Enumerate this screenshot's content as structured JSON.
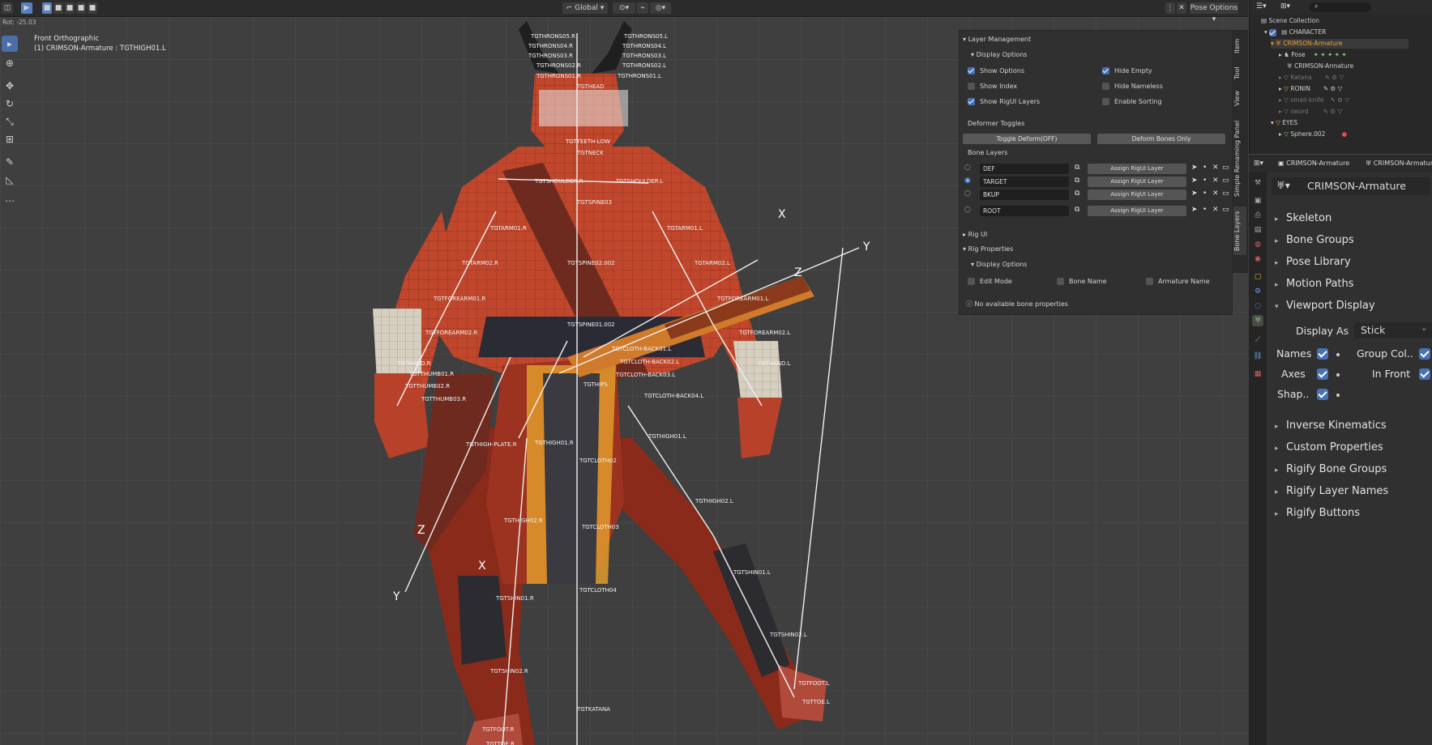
{
  "header": {
    "orientation": "Global",
    "pose_options": "Pose Options"
  },
  "viewport": {
    "coord_readout": "Rot: -25.03",
    "view_name": "Front Orthographic",
    "active_object": "(1) CRIMSON-Armature : TGTHIGH01.L",
    "bone_labels": [
      "TGTHRONS05.R",
      "TGTHRONS05.L",
      "TGTHRONS04.R",
      "TGTHRONS04.L",
      "TGTHRONS03.R",
      "TGTHRONS03.L",
      "TGTHRONS02.R",
      "TGTHRONS02.L",
      "TGTHRONS01.R",
      "TGTHRONS01.L",
      "TGTHEAD",
      "TGTNECK",
      "TGTTEETH-LOW",
      "TGTSHOULDER.R",
      "TGTSHOULDER.L",
      "TGTSPINE03",
      "TGTARM01.R",
      "TGTARM01.L",
      "TGTARM02.R",
      "TGTARM02.L",
      "TGTSPINE02.002",
      "TGTFOREARM01.R",
      "TGTFOREARM01.L",
      "TGTFOREARM02.R",
      "TGTFOREARM02.L",
      "TGTSPINE01.002",
      "TGTCLOTH-BACK01.L",
      "TGTHAND.R",
      "TGTHAND.L",
      "TGTCLOTH-BACK02.L",
      "TGTTHUMB01.R",
      "TGTCLOTH-BACK03.L",
      "TGTTHUMB02.R",
      "TGTCLOTH-BACK04.L",
      "TGTTHUMB03.R",
      "TGTHIPS",
      "TGTHIGH01.L",
      "TGTHIGH-PLATE.R",
      "TGTHIGH01.R",
      "TGTCLOTH02",
      "TGTHIGH02.L",
      "TGTHIGH02.R",
      "TGTCLOTH03",
      "TGTSHIN01.L",
      "TGTSHIN01.R",
      "TGTCLOTH04",
      "TGTSHIN02.L",
      "TGTSHIN02.R",
      "TGTKATANA",
      "TGTFOOT.L",
      "TGTTOE.L",
      "TGTFOOT.R",
      "TGTTOE.R"
    ]
  },
  "npanel": {
    "layer_management": "Layer Management",
    "display_options": "Display Options",
    "options": [
      {
        "label": "Show Options",
        "checked": true
      },
      {
        "label": "Hide Empty",
        "checked": true
      },
      {
        "label": "Show Index",
        "checked": false
      },
      {
        "label": "Hide Nameless",
        "checked": false
      },
      {
        "label": "Show RigUI Layers",
        "checked": true
      },
      {
        "label": "Enable Sorting",
        "checked": false
      }
    ],
    "deformer_toggles": "Deformer Toggles",
    "toggle_deform": "Toggle Deform(OFF)",
    "deform_bones_only": "Deform Bones Only",
    "bone_layers": "Bone Layers",
    "layers": [
      {
        "name": "DEF",
        "assign": "Assign RigUI Layer"
      },
      {
        "name": "TARGET",
        "assign": "Assign RigUI Layer"
      },
      {
        "name": "BKUP",
        "assign": "Assign RigUI Layer"
      },
      {
        "name": "ROOT",
        "assign": "Assign RigUI Layer"
      }
    ],
    "rig_ui": "Rig UI",
    "rig_properties": "Rig Properties",
    "display_options2": "Display Options",
    "rig_opts": [
      {
        "label": "Edit Mode",
        "checked": false
      },
      {
        "label": "Bone Name",
        "checked": false
      },
      {
        "label": "Armature Name",
        "checked": false
      }
    ],
    "no_props": "No available bone properties"
  },
  "vtabs": [
    "Item",
    "Tool",
    "View",
    "Simple Renaming Panel",
    "Bone Layers"
  ],
  "outliner": {
    "rows": [
      "Scene Collection",
      "CHARACTER",
      "CRIMSON-Armature",
      "Pose",
      "CRIMSON-Armature",
      "Katana",
      "RONIN",
      "small-knife",
      "sword",
      "EYES",
      "Sphere.002"
    ]
  },
  "props_header": {
    "left": "CRIMSON-Armature",
    "right": "CRIMSON-Armature"
  },
  "properties": {
    "object_name": "CRIMSON-Armature",
    "sections_top": [
      "Skeleton",
      "Bone Groups",
      "Pose Library",
      "Motion Paths"
    ],
    "viewport_display": "Viewport Display",
    "display_as_label": "Display As",
    "display_as_value": "Stick",
    "names": "Names",
    "group_col": "Group Col..",
    "axes": "Axes",
    "in_front": "In Front",
    "shape": "Shap..",
    "sections_bottom": [
      "Inverse Kinematics",
      "Custom Properties",
      "Rigify Bone Groups",
      "Rigify Layer Names",
      "Rigify Buttons"
    ]
  },
  "colors": {
    "accent": "#4772b3",
    "active_orange": "#f0a43a",
    "character_red": "#c0472c"
  }
}
